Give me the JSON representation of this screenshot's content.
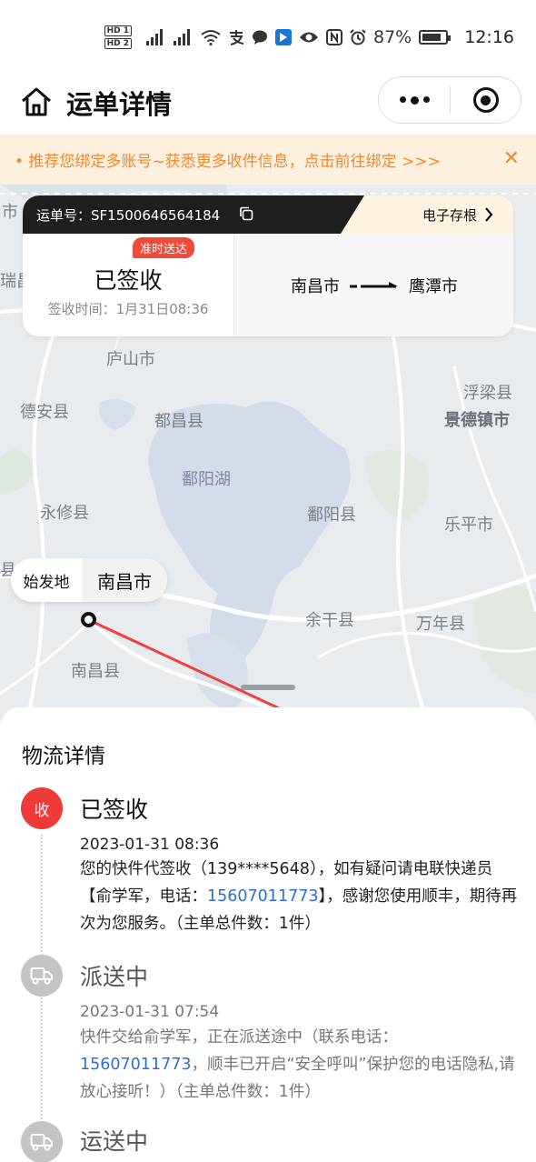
{
  "status_bar": {
    "hd1": "HD 1",
    "hd2": "HD 2",
    "battery": "87%",
    "time": "12:16",
    "icons": [
      "signal-icon",
      "signal-icon",
      "wifi-icon",
      "alipay-icon",
      "chat-icon",
      "app-notification-icon",
      "eye-icon",
      "nfc-icon",
      "alarm-icon",
      "battery-icon"
    ]
  },
  "nav": {
    "title": "运单详情",
    "icons": [
      "home-icon",
      "more-dots-icon",
      "target-icon"
    ]
  },
  "banner": {
    "text": "• 推荐您绑定多账号~获悉更多收件信息，点击前往绑定 >>>",
    "close": "✕"
  },
  "card": {
    "waybill": "运单号：SF1500646564184",
    "archive_label": "电子存根",
    "badge": "准时送达",
    "status": "已签收",
    "sign_time": "签收时间：1月31日08:36",
    "origin_city": "南昌市",
    "dest_city": "鹰潭市"
  },
  "map": {
    "labels": {
      "lushan": "庐山市",
      "de_an": "德安县",
      "duchang": "都昌县",
      "fuliang": "浮梁县",
      "jingdezhen": "景德镇市",
      "poyang_lake": "鄱阳湖",
      "poyang": "鄱阳县",
      "yongxiu": "永修县",
      "leping": "乐平市",
      "yugan": "余干县",
      "wannian": "万年县",
      "nanchang_county": "南昌县",
      "edge_shi": "市",
      "edge_rui": "瑞昌",
      "edge_xian": "县"
    },
    "origin_tag": "始发地",
    "origin_city": "南昌市"
  },
  "logistics": {
    "title": "物流详情",
    "events": [
      {
        "icon_label": "收",
        "title": "已签收",
        "time": "2023-01-31 08:36",
        "desc_a": "您的快件代签收（139****5648），如有疑问请电联快递员【俞学军，电话：",
        "phone": "15607011773",
        "desc_b": "】，感谢您使用顺丰，期待再次为您服务。（主单总件数：1件）"
      },
      {
        "title": "派送中",
        "time": "2023-01-31 07:54",
        "desc_a": "快件交给俞学军，正在派送途中（联系电话：",
        "phone": "15607011773",
        "desc_b": "，顺丰已开启“安全呼叫”保护您的电话隐私,请放心接听！）（主单总件数：1件）"
      },
      {
        "title": "运送中"
      }
    ]
  }
}
